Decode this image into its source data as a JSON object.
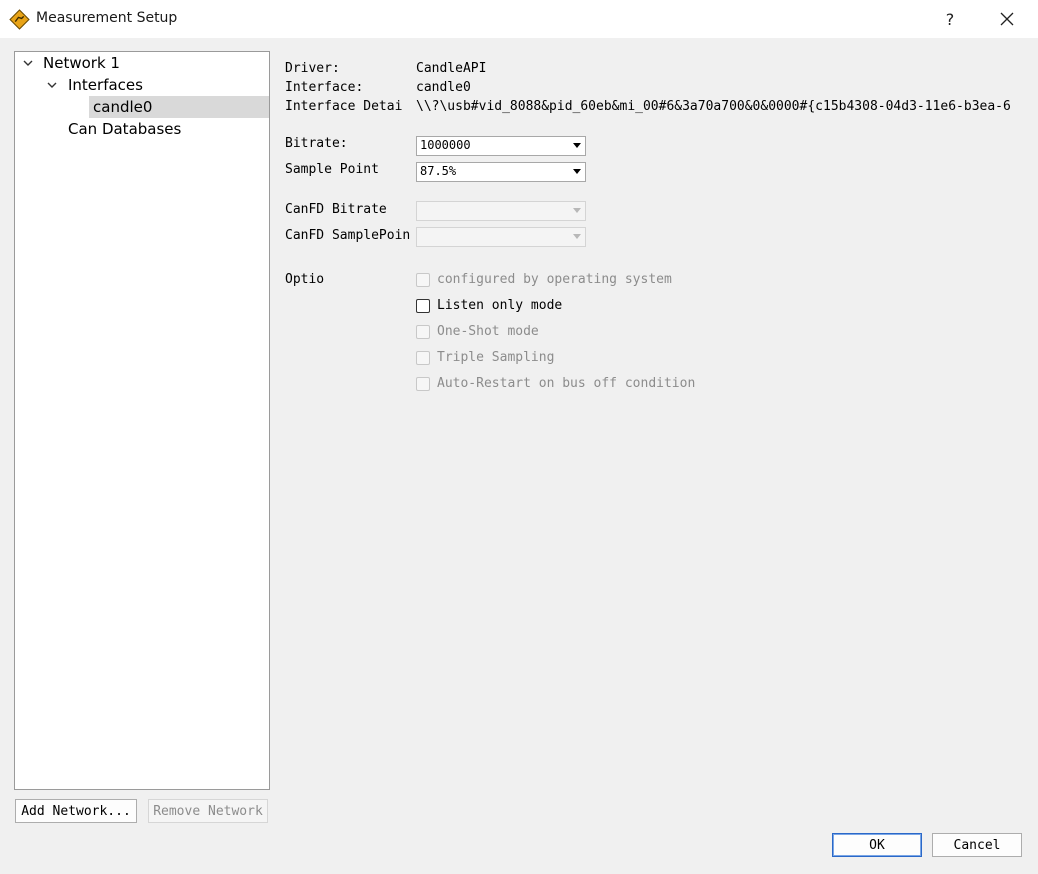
{
  "window": {
    "title": "Measurement Setup",
    "help_label": "?"
  },
  "tree": {
    "network": "Network 1",
    "interfaces": "Interfaces",
    "interface_item": "candle0",
    "databases": "Can Databases"
  },
  "details": {
    "driver_label": "Driver:",
    "driver_value": "CandleAPI",
    "interface_label": "Interface:",
    "interface_value": "candle0",
    "interface_details_label": "Interface Detai",
    "interface_details_value": "\\\\?\\usb#vid_8088&pid_60eb&mi_00#6&3a70a700&0&0000#{c15b4308-04d3-11e6-b3ea-6"
  },
  "settings": {
    "bitrate_label": "Bitrate:",
    "bitrate_value": "1000000",
    "sample_point_label": "Sample Point",
    "sample_point_value": "87.5%",
    "canfd_bitrate_label": "CanFD Bitrate",
    "canfd_samplepoint_label": "CanFD SamplePoin"
  },
  "options": {
    "label": "Optio",
    "items": [
      {
        "label": "configured by operating system",
        "enabled": false,
        "checked": false
      },
      {
        "label": "Listen only mode",
        "enabled": true,
        "checked": false
      },
      {
        "label": "One-Shot mode",
        "enabled": false,
        "checked": false
      },
      {
        "label": "Triple Sampling",
        "enabled": false,
        "checked": false
      },
      {
        "label": "Auto-Restart on bus off condition",
        "enabled": false,
        "checked": false
      }
    ]
  },
  "buttons": {
    "add_network": "Add Network...",
    "remove_network": "Remove Network",
    "ok": "OK",
    "cancel": "Cancel"
  },
  "colors": {
    "background": "#f0f0f0",
    "selection": "#d9d9d9",
    "accent": "#2a68c8",
    "icon_fill": "#e8a317"
  }
}
